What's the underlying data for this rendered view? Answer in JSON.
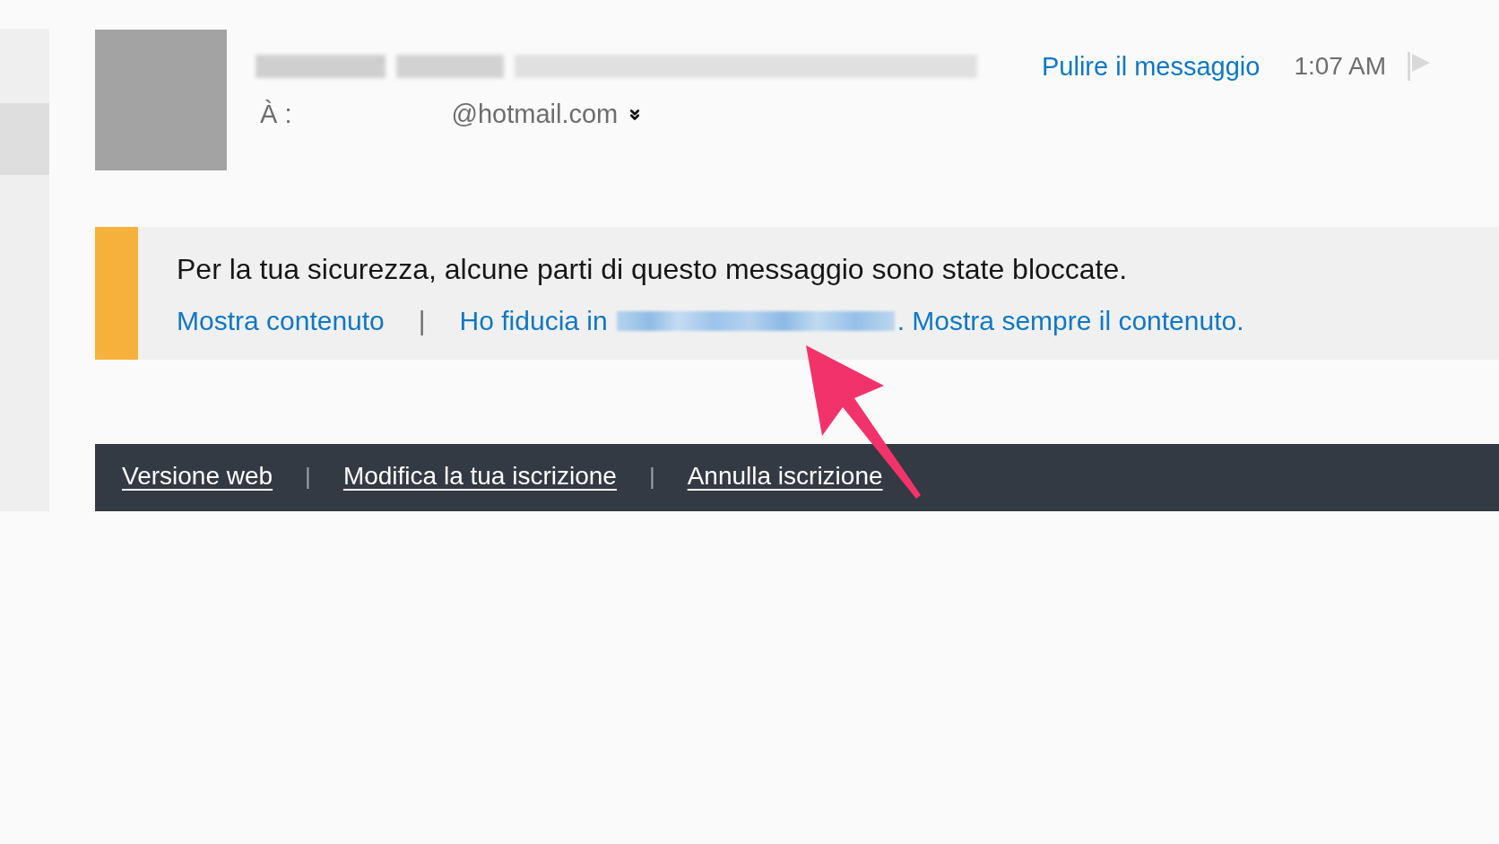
{
  "message_header": {
    "to_label": "À :",
    "to_address": "@hotmail.com",
    "clean_up_link": "Pulire il messaggio",
    "time": "1:07 AM",
    "flagged": false
  },
  "security_notice": {
    "message": "Per la tua sicurezza, alcune parti di questo messaggio sono state bloccate.",
    "actions": [
      {
        "kind": "link",
        "label": "Mostra contenuto"
      },
      {
        "kind": "separator",
        "label": "|"
      },
      {
        "kind": "link",
        "label": "Ho fiducia in"
      },
      {
        "kind": "redacted"
      },
      {
        "kind": "link",
        "label": ". Mostra sempre il contenuto."
      }
    ]
  },
  "footer": {
    "items": [
      {
        "kind": "link",
        "label": "Versione web"
      },
      {
        "kind": "separator",
        "label": "|"
      },
      {
        "kind": "link",
        "label": "Modifica la tua iscrizione"
      },
      {
        "kind": "separator",
        "label": "|"
      },
      {
        "kind": "link",
        "label": "Annulla iscrizione"
      }
    ]
  }
}
